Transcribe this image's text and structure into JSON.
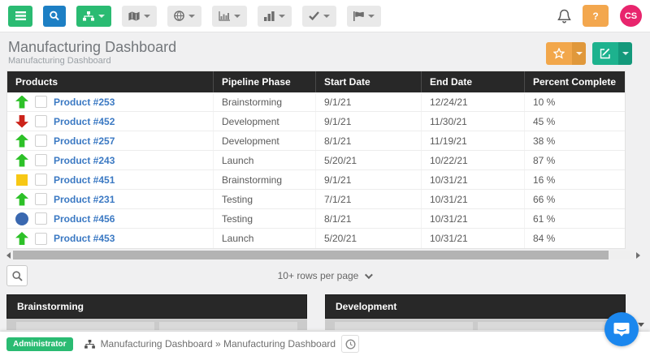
{
  "toolbar": {
    "icons": [
      "menu-icon",
      "search-icon",
      "sitemap-icon",
      "map-icon",
      "globe-icon",
      "column-chart-icon",
      "bar-chart-icon",
      "check-icon",
      "flag-icon",
      "bell-icon"
    ],
    "help_label": "?",
    "avatar_initials": "CS"
  },
  "header": {
    "title": "Manufacturing Dashboard",
    "subtitle": "Manufacturing Dashboard"
  },
  "table": {
    "columns": [
      "Products",
      "Pipeline Phase",
      "Start Date",
      "End Date",
      "Percent Complete"
    ],
    "rows": [
      {
        "icon_class": "rstatus s-up",
        "icon_name": "arrow-up-green",
        "product": "Product #253",
        "phase": "Brainstorming",
        "start": "9/1/21",
        "end": "12/24/21",
        "percent": "10 %"
      },
      {
        "icon_class": "rstatus s-down",
        "icon_name": "arrow-down-red",
        "product": "Product #452",
        "phase": "Development",
        "start": "9/1/21",
        "end": "11/30/21",
        "percent": "45 %"
      },
      {
        "icon_class": "rstatus s-up",
        "icon_name": "arrow-up-green",
        "product": "Product #257",
        "phase": "Development",
        "start": "8/1/21",
        "end": "11/19/21",
        "percent": "38 %"
      },
      {
        "icon_class": "rstatus s-up",
        "icon_name": "arrow-up-green",
        "product": "Product #243",
        "phase": "Launch",
        "start": "5/20/21",
        "end": "10/22/21",
        "percent": "87 %"
      },
      {
        "icon_class": "rstatus s-square",
        "icon_name": "yellow-square",
        "product": "Product #451",
        "phase": "Brainstorming",
        "start": "9/1/21",
        "end": "10/31/21",
        "percent": "16 %"
      },
      {
        "icon_class": "rstatus s-up",
        "icon_name": "arrow-up-green",
        "product": "Product #231",
        "phase": "Testing",
        "start": "7/1/21",
        "end": "10/31/21",
        "percent": "66 %"
      },
      {
        "icon_class": "rstatus s-circle",
        "icon_name": "blue-circle",
        "product": "Product #456",
        "phase": "Testing",
        "start": "8/1/21",
        "end": "10/31/21",
        "percent": "61 %"
      },
      {
        "icon_class": "rstatus s-up",
        "icon_name": "arrow-up-green",
        "product": "Product #453",
        "phase": "Launch",
        "start": "5/20/21",
        "end": "10/31/21",
        "percent": "84 %"
      }
    ]
  },
  "pagination": {
    "rows_per_page": "10+ rows per page"
  },
  "panels": [
    {
      "title": "Brainstorming"
    },
    {
      "title": "Development"
    }
  ],
  "footer": {
    "role_badge": "Administrator",
    "breadcrumb": "Manufacturing Dashboard » Manufacturing Dashboard"
  },
  "colors": {
    "accent_green": "#2abb72",
    "accent_blue": "#1d7fc4",
    "accent_orange": "#f2a74b",
    "accent_teal": "#1db28e",
    "avatar_pink": "#e8256d",
    "chat_blue": "#1b87ee",
    "table_header_bg": "#282828",
    "link_blue": "#3b79c3",
    "status_up": "#2dc128",
    "status_down": "#cc231a",
    "status_square": "#f7c815",
    "status_circle": "#3a68b0"
  }
}
